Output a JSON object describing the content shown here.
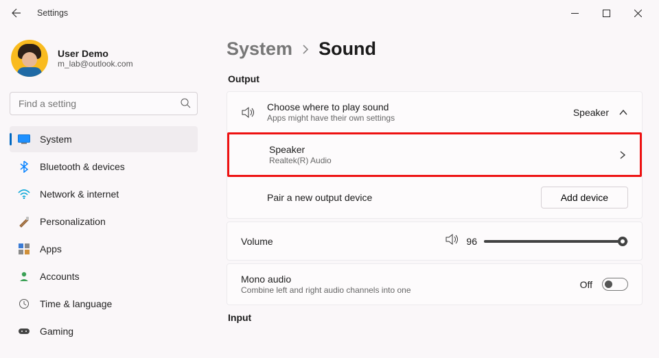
{
  "titlebar": {
    "title": "Settings"
  },
  "profile": {
    "name": "User Demo",
    "email": "m_lab@outlook.com"
  },
  "search": {
    "placeholder": "Find a setting"
  },
  "nav": {
    "items": [
      {
        "label": "System"
      },
      {
        "label": "Bluetooth & devices"
      },
      {
        "label": "Network & internet"
      },
      {
        "label": "Personalization"
      },
      {
        "label": "Apps"
      },
      {
        "label": "Accounts"
      },
      {
        "label": "Time & language"
      },
      {
        "label": "Gaming"
      }
    ]
  },
  "breadcrumb": {
    "parent": "System",
    "current": "Sound"
  },
  "output": {
    "section_title": "Output",
    "choose": {
      "title": "Choose where to play sound",
      "subtitle": "Apps might have their own settings",
      "value": "Speaker"
    },
    "speaker": {
      "title": "Speaker",
      "subtitle": "Realtek(R) Audio"
    },
    "pair": {
      "title": "Pair a new output device",
      "button": "Add device"
    },
    "volume": {
      "label": "Volume",
      "value": "96"
    },
    "mono": {
      "title": "Mono audio",
      "subtitle": "Combine left and right audio channels into one",
      "state": "Off"
    }
  },
  "input": {
    "section_title": "Input"
  }
}
